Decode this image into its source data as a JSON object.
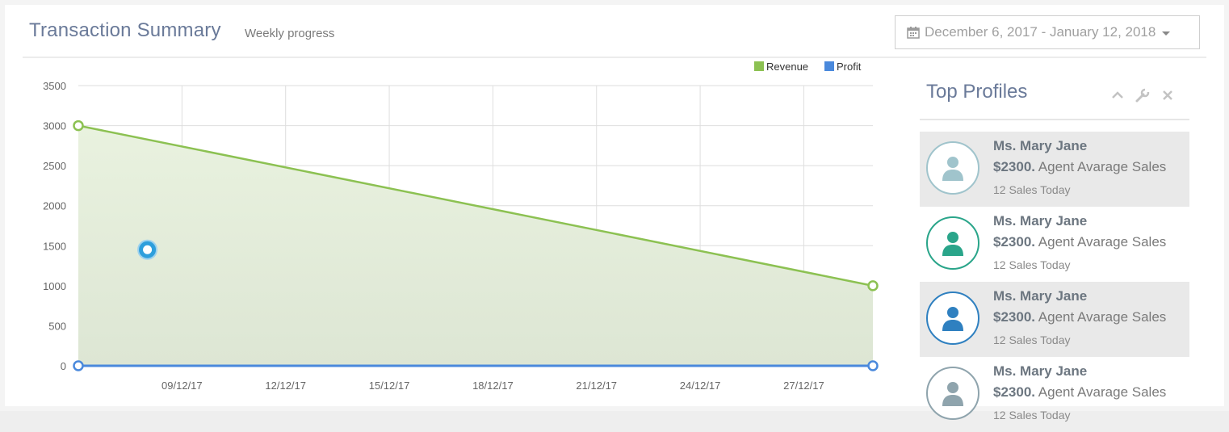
{
  "header": {
    "title": "Transaction Summary",
    "subtitle": "Weekly progress",
    "date_range": "December 6, 2017 - January 12, 2018"
  },
  "icons": {
    "date": "calendar-icon",
    "caret": "caret-down-icon",
    "collapse": "chevron-up-icon",
    "settings": "wrench-icon",
    "close": "close-icon",
    "avatar": "user-icon"
  },
  "colors": {
    "revenue": "#8cc152",
    "profit": "#4a89dc",
    "title": "#6a7a99"
  },
  "chart_data": {
    "type": "line",
    "legend": [
      "Revenue",
      "Profit"
    ],
    "legend_position": "top-right",
    "series": [
      {
        "name": "Revenue",
        "x": [
          "2017-12-06",
          "2017-12-29"
        ],
        "y": [
          3000,
          1000
        ],
        "fill": true
      },
      {
        "name": "Profit",
        "x": [
          "2017-12-06",
          "2017-12-29"
        ],
        "y": [
          0,
          0
        ],
        "fill": false
      }
    ],
    "highlight_point": {
      "series": "Profit",
      "x": "2017-12-08",
      "y": 1450
    },
    "x_ticks": [
      "09/12/17",
      "12/12/17",
      "15/12/17",
      "18/12/17",
      "21/12/17",
      "24/12/17",
      "27/12/17"
    ],
    "y_ticks": [
      0,
      500,
      1000,
      1500,
      2000,
      2500,
      3000,
      3500
    ],
    "xlim": [
      "2017-12-06",
      "2017-12-29"
    ],
    "ylim": [
      0,
      3500
    ],
    "grid": true
  },
  "top_profiles": {
    "title": "Top Profiles",
    "items": [
      {
        "name": "Ms. Mary Jane",
        "amount": "$2300.",
        "label": "Agent Avarage Sales",
        "today": "12 Sales Today",
        "color": "#a0c4cc",
        "shaded": true
      },
      {
        "name": "Ms. Mary Jane",
        "amount": "$2300.",
        "label": "Agent Avarage Sales",
        "today": "12 Sales Today",
        "color": "#2aa58a",
        "shaded": false
      },
      {
        "name": "Ms. Mary Jane",
        "amount": "$2300.",
        "label": "Agent Avarage Sales",
        "today": "12 Sales Today",
        "color": "#2f80c0",
        "shaded": true
      },
      {
        "name": "Ms. Mary Jane",
        "amount": "$2300.",
        "label": "Agent Avarage Sales",
        "today": "12 Sales Today",
        "color": "#8fa4ad",
        "shaded": false
      }
    ]
  }
}
